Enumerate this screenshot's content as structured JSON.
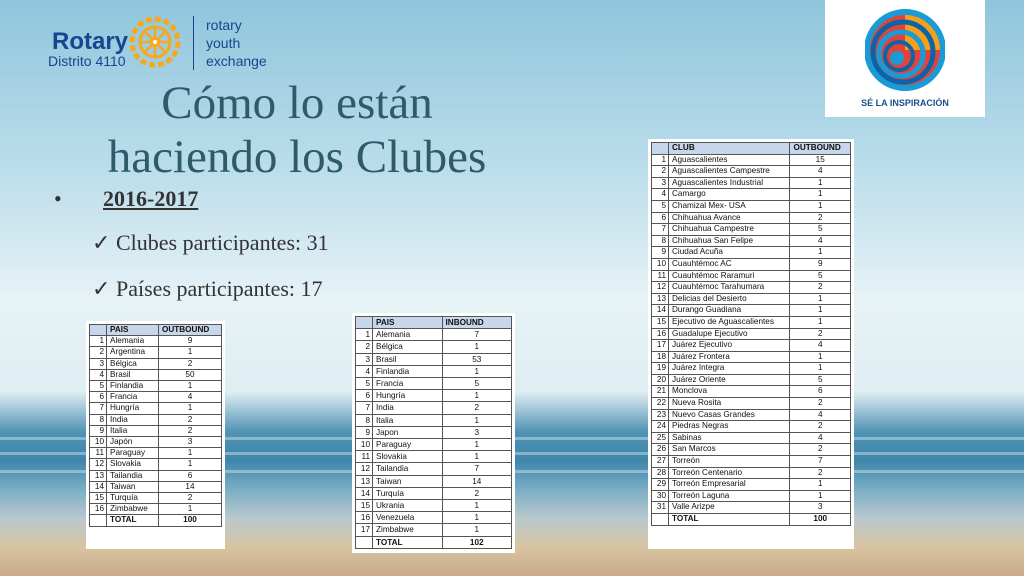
{
  "header": {
    "rotary": "Rotary",
    "district": "Distrito 4110",
    "ryex_line1": "rotary",
    "ryex_line2": "youth",
    "ryex_line3": "exchange",
    "emblem_caption": "SÉ LA INSPIRACIÓN"
  },
  "title": {
    "line1": "Cómo lo están",
    "line2": "haciendo los Clubes"
  },
  "bullet": {
    "marker": "•",
    "year": "2016-2017"
  },
  "checks": [
    {
      "mark": "✓",
      "text": "Clubes participantes: 31"
    },
    {
      "mark": "✓",
      "text": "Países participantes: 17"
    }
  ],
  "colors": {
    "title": "#2f5a69",
    "header_blue": "#17458f",
    "table_header": "#c7d6ea"
  },
  "table_outbound_countries": {
    "headers": [
      "",
      "PAIS",
      "OUTBOUND"
    ],
    "rows": [
      [
        "1",
        "Alemania",
        "9"
      ],
      [
        "2",
        "Argentina",
        "1"
      ],
      [
        "3",
        "Bélgica",
        "2"
      ],
      [
        "4",
        "Brasil",
        "50"
      ],
      [
        "5",
        "Finlandia",
        "1"
      ],
      [
        "6",
        "Francia",
        "4"
      ],
      [
        "7",
        "Hungría",
        "1"
      ],
      [
        "8",
        "India",
        "2"
      ],
      [
        "9",
        "Italia",
        "2"
      ],
      [
        "10",
        "Japón",
        "3"
      ],
      [
        "11",
        "Paraguay",
        "1"
      ],
      [
        "12",
        "Slovakia",
        "1"
      ],
      [
        "13",
        "Tailandia",
        "6"
      ],
      [
        "14",
        "Taiwan",
        "14"
      ],
      [
        "15",
        "Turquía",
        "2"
      ],
      [
        "16",
        "Zimbabwe",
        "1"
      ]
    ],
    "total_label": "TOTAL",
    "total_value": "100"
  },
  "table_inbound_countries": {
    "headers": [
      "",
      "PAIS",
      "INBOUND"
    ],
    "rows": [
      [
        "1",
        "Alemania",
        "7"
      ],
      [
        "2",
        "Bélgica",
        "1"
      ],
      [
        "3",
        "Brasil",
        "53"
      ],
      [
        "4",
        "Finlandia",
        "1"
      ],
      [
        "5",
        "Francia",
        "5"
      ],
      [
        "6",
        "Hungría",
        "1"
      ],
      [
        "7",
        "India",
        "2"
      ],
      [
        "8",
        "Italia",
        "1"
      ],
      [
        "9",
        "Japon",
        "3"
      ],
      [
        "10",
        "Paraguay",
        "1"
      ],
      [
        "11",
        "Slovakia",
        "1"
      ],
      [
        "12",
        "Tailandia",
        "7"
      ],
      [
        "13",
        "Taiwan",
        "14"
      ],
      [
        "14",
        "Turquía",
        "2"
      ],
      [
        "15",
        "Ukrania",
        "1"
      ],
      [
        "16",
        "Venezuela",
        "1"
      ],
      [
        "17",
        "Zimbabwe",
        "1"
      ]
    ],
    "total_label": "TOTAL",
    "total_value": "102"
  },
  "table_clubs": {
    "headers": [
      "",
      "CLUB",
      "OUTBOUND"
    ],
    "rows": [
      [
        "1",
        "Aguascalientes",
        "15"
      ],
      [
        "2",
        "Aguascalientes Campestre",
        "4"
      ],
      [
        "3",
        "Aguascalientes Industrial",
        "1"
      ],
      [
        "4",
        "Camargo",
        "1"
      ],
      [
        "5",
        "Chamizal Mex- USA",
        "1"
      ],
      [
        "6",
        "Chihuahua Avance",
        "2"
      ],
      [
        "7",
        "Chihuahua Campestre",
        "5"
      ],
      [
        "8",
        "Chihuahua San Felipe",
        "4"
      ],
      [
        "9",
        "Ciudad Acuña",
        "1"
      ],
      [
        "10",
        "Cuauhtémoc AC",
        "9"
      ],
      [
        "11",
        "Cuauhtémoc Raramuri",
        "5"
      ],
      [
        "12",
        "Cuauhtémoc Tarahumara",
        "2"
      ],
      [
        "13",
        "Delicias del Desierto",
        "1"
      ],
      [
        "14",
        "Durango Guadiana",
        "1"
      ],
      [
        "15",
        "Ejecutivo de Aguascalientes",
        "1"
      ],
      [
        "16",
        "Guadalupe Ejecutivo",
        "2"
      ],
      [
        "17",
        "Juárez Ejecutivo",
        "4"
      ],
      [
        "18",
        "Juárez Frontera",
        "1"
      ],
      [
        "19",
        "Juárez Integra",
        "1"
      ],
      [
        "20",
        "Juárez Oriente",
        "5"
      ],
      [
        "21",
        "Monclova",
        "6"
      ],
      [
        "22",
        "Nueva Rosita",
        "2"
      ],
      [
        "23",
        "Nuevo Casas Grandes",
        "4"
      ],
      [
        "24",
        "Piedras Negras",
        "2"
      ],
      [
        "25",
        "Sabinas",
        "4"
      ],
      [
        "26",
        "San Marcos",
        "2"
      ],
      [
        "27",
        "Torreón",
        "7"
      ],
      [
        "28",
        "Torreón Centenario",
        "2"
      ],
      [
        "29",
        "Torreón Empresarial",
        "1"
      ],
      [
        "30",
        "Torreón Laguna",
        "1"
      ],
      [
        "31",
        "Valle Arizpe",
        "3"
      ]
    ],
    "total_label": "TOTAL",
    "total_value": "100"
  }
}
